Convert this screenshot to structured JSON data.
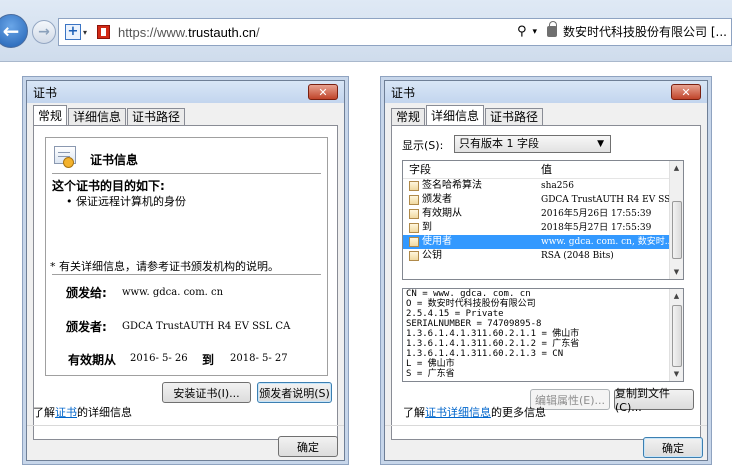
{
  "browser": {
    "url_prefix": "https://www.",
    "url_main": "trustauth.cn",
    "url_suffix": "/",
    "search_caret": "▾",
    "company": "数安时代科技股份有限公司 [..."
  },
  "general_dialog": {
    "title": "证书",
    "close": "✕",
    "tabs": [
      "常规",
      "详细信息",
      "证书路径"
    ],
    "info_title": "证书信息",
    "purpose_heading": "这个证书的目的如下:",
    "purpose_item": "• 保证远程计算机的身份",
    "note": "* 有关详细信息，请参考证书颁发机构的说明。",
    "issued_to_label": "颁发给:",
    "issued_to_value": "www. gdca. com. cn",
    "issued_by_label": "颁发者:",
    "issued_by_value": "GDCA TrustAUTH R4 EV SSL CA",
    "validity_label": "有效期从",
    "valid_from": "2016- 5- 26",
    "to_label": "到",
    "valid_to": "2018- 5- 27",
    "install_button": "安装证书(I)...",
    "issuer_statement_button": "颁发者说明(S)",
    "learn_prefix": "了解",
    "learn_link": "证书",
    "learn_suffix": "的详细信息",
    "ok_button": "确定"
  },
  "details_dialog": {
    "title": "证书",
    "close": "✕",
    "tabs": [
      "常规",
      "详细信息",
      "证书路径"
    ],
    "show_label": "显示(S):",
    "show_value": "只有版本 1 字段",
    "columns": [
      "字段",
      "值"
    ],
    "fields": [
      {
        "field": "签名哈希算法",
        "value": "sha256"
      },
      {
        "field": "颁发者",
        "value": "GDCA TrustAUTH R4 EV SS..."
      },
      {
        "field": "有效期从",
        "value": "2016年5月26日 17:55:39"
      },
      {
        "field": "到",
        "value": "2018年5月27日 17:55:39"
      },
      {
        "field": "使用者",
        "value": "www. gdca. com. cn, 数安时..."
      },
      {
        "field": "公钥",
        "value": "RSA (2048 Bits)"
      }
    ],
    "detail_lines": [
      "CN = www. gdca. com. cn",
      "O = 数安时代科技股份有限公司",
      "2.5.4.15 = Private",
      "SERIALNUMBER = 74709895-8",
      "1.3.6.1.4.1.311.60.2.1.1 = 佛山市",
      "1.3.6.1.4.1.311.60.2.1.2 = 广东省",
      "1.3.6.1.4.1.311.60.2.1.3 = CN",
      "L = 佛山市",
      "S = 广东省"
    ],
    "edit_button": "编辑属性(E)...",
    "copy_button": "复制到文件(C)...",
    "learn_prefix": "了解",
    "learn_link": "证书详细信息",
    "learn_suffix": "的更多信息",
    "ok_button": "确定"
  },
  "colors": {
    "selection": "#3399ff",
    "link": "#0066cc",
    "close_button": "#c0442a"
  }
}
